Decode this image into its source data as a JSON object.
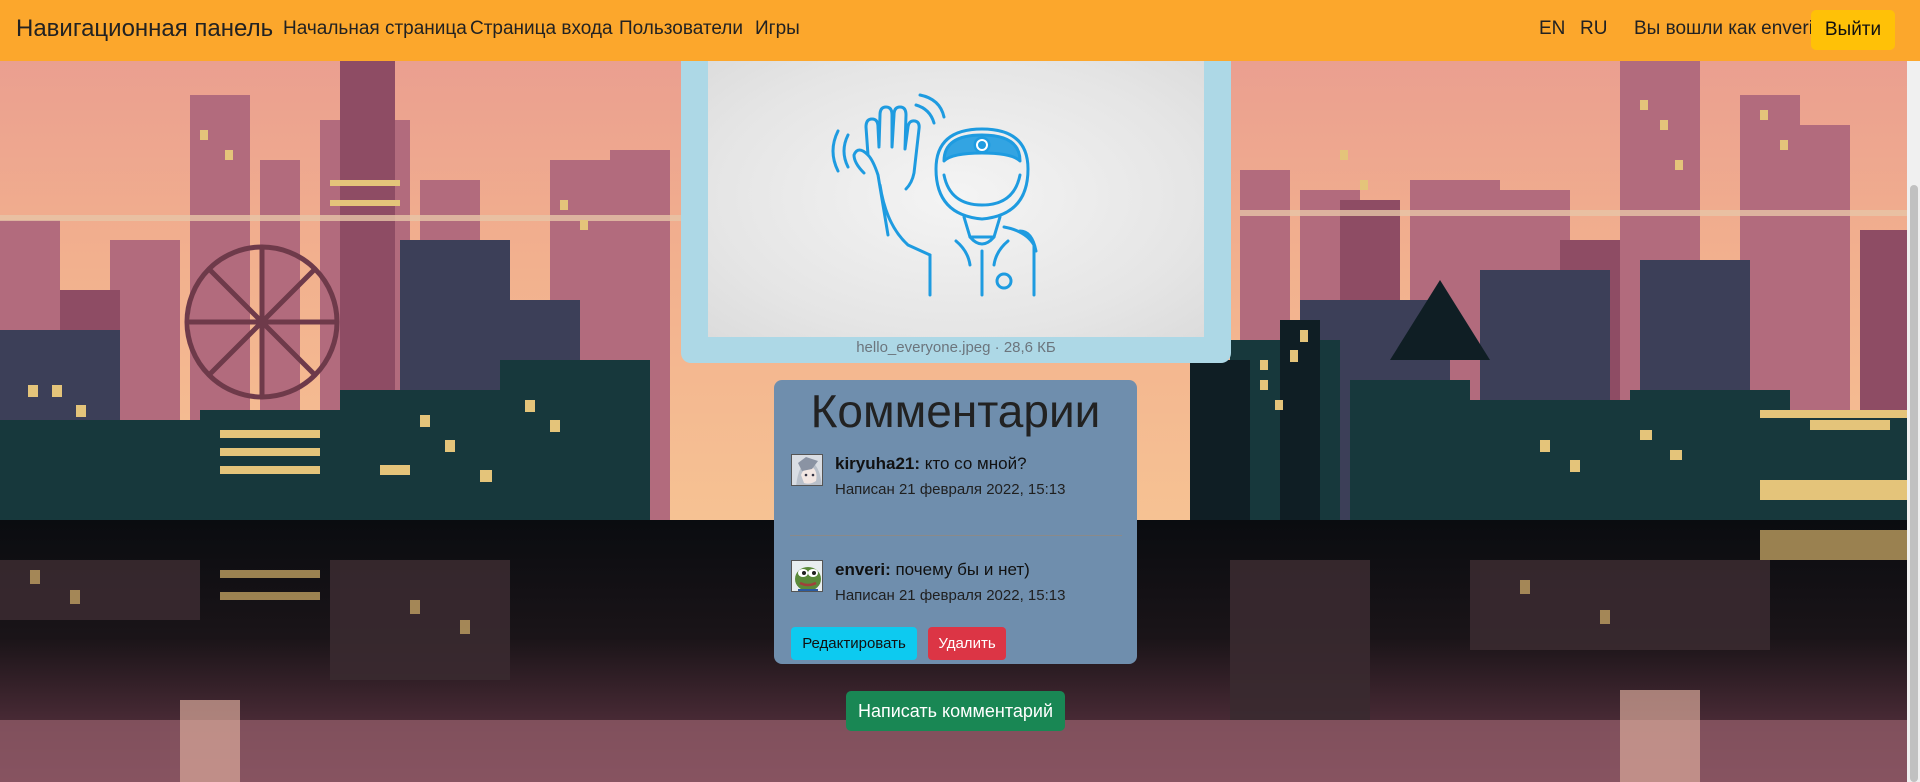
{
  "navbar": {
    "brand": "Навигационная панель",
    "links": [
      {
        "label": "Начальная страница"
      },
      {
        "label": "Страница входа"
      },
      {
        "label": "Пользователи"
      },
      {
        "label": "Игры"
      }
    ],
    "lang_en": "EN",
    "lang_ru": "RU",
    "logged_in_text": "Вы вошли как enveri",
    "logout_label": "Выйти",
    "bg_color": "#fca72c"
  },
  "post": {
    "image_caption": "hello_everyone.jpeg · 28,6 КБ",
    "image_icon": "waving-astronaut-icon"
  },
  "comments": {
    "title": "Комментарии",
    "items": [
      {
        "author": "kiryuha21:",
        "text": " кто со мной?",
        "date": "Написан 21 февраля 2022, 15:13",
        "avatar_icon": "anime-avatar"
      },
      {
        "author": "enveri:",
        "text": " почему бы и нет)",
        "date": "Написан 21 февраля 2022, 15:13",
        "avatar_icon": "pepe-avatar"
      }
    ],
    "edit_label": "Редактировать",
    "delete_label": "Удалить"
  },
  "write_comment_label": "Написать комментарий",
  "colors": {
    "edit": "#0dcaf0",
    "delete": "#dc3545",
    "write": "#198754",
    "comments_card": "#6f8ead",
    "image_card": "#add8e6"
  }
}
